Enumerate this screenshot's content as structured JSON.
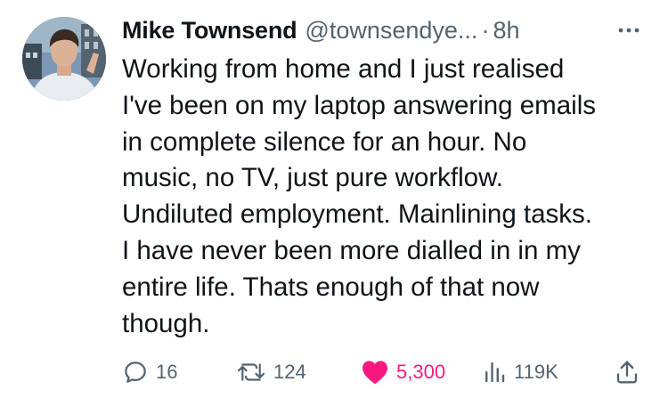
{
  "tweet": {
    "author_name": "Mike Townsend",
    "handle": "@townsendye...",
    "separator": "·",
    "time": "8h",
    "text": "Working from home and I just realised\nI've been on my laptop answering emails\nin complete silence for an hour. No\nmusic, no TV, just pure workflow.\nUndiluted employment. Mainlining tasks.\nI have never been more dialled in in my\nentire life. Thats enough of that now\nthough."
  },
  "icons": {
    "more": "more-icon",
    "reply": "reply-icon",
    "retweet": "retweet-icon",
    "like": "heart-icon",
    "views": "views-icon",
    "share": "share-icon"
  },
  "metrics": {
    "replies": "16",
    "retweets": "124",
    "likes": "5,300",
    "views": "119K"
  },
  "colors": {
    "text": "#0f1419",
    "secondary": "#536471",
    "like": "#f91880",
    "background": "#ffffff"
  }
}
